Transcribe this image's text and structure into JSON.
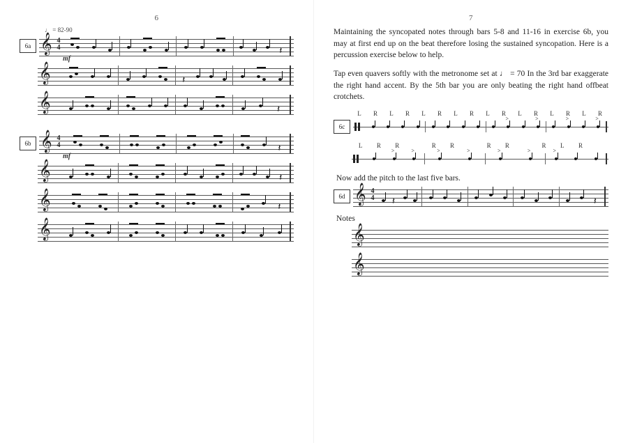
{
  "pages": {
    "left_num": "6",
    "right_num": "7"
  },
  "tempo_marking": "♩ = 82-90",
  "dynamic_mf": "mf",
  "exercise_labels": {
    "six_a": "6a",
    "six_b": "6b",
    "six_c": "6c",
    "six_d": "6d"
  },
  "time_signature": {
    "top": "4",
    "bottom": "4"
  },
  "paragraphs": {
    "p1": "Maintaining the syncopated notes through bars 5-8 and 11-16 in exercise 6b, you may at first end up on the beat therefore losing the sustained syncopation. Here is a percussion exercise below to help.",
    "p2": "Tap even quavers softly with the metronome set at ♩ = 70 In the 3rd bar exaggerate the right hand accent. By the 5th bar you are only beating the right hand offbeat crotchets."
  },
  "sticking": {
    "line1": [
      "L",
      "R",
      "L",
      "R",
      "L",
      "R",
      "L",
      "R",
      "L",
      "R",
      "L",
      "R",
      "L",
      "R",
      "L",
      "R"
    ],
    "line2": [
      "L",
      "R",
      "R",
      "",
      "R",
      "R",
      "",
      "R",
      "R",
      "",
      "R",
      "L",
      "R",
      ""
    ]
  },
  "subheads": {
    "add_pitch": "Now add the pitch to the last five bars.",
    "notes": "Notes"
  }
}
